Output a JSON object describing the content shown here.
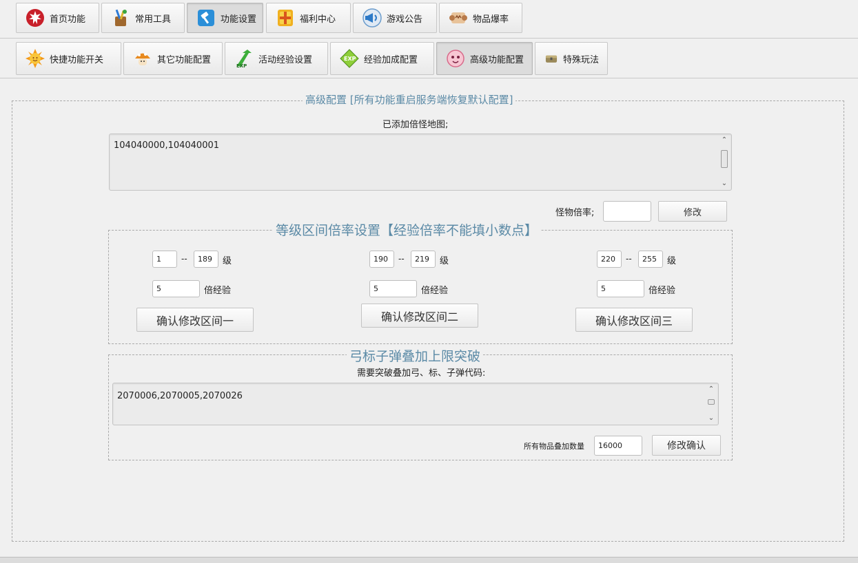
{
  "top_tabs": [
    {
      "label": "首页功能",
      "icon": "maple-leaf-icon"
    },
    {
      "label": "常用工具",
      "icon": "toolbox-icon"
    },
    {
      "label": "功能设置",
      "icon": "hammer-icon"
    },
    {
      "label": "福利中心",
      "icon": "gift-icon"
    },
    {
      "label": "游戏公告",
      "icon": "megaphone-icon"
    },
    {
      "label": "物品爆率",
      "icon": "scroll-icon"
    }
  ],
  "sub_tabs": [
    {
      "label": "快捷功能开关",
      "icon": "sun-icon"
    },
    {
      "label": "其它功能配置",
      "icon": "mushroom-icon"
    },
    {
      "label": "活动经验设置",
      "icon": "exp-arrow-icon"
    },
    {
      "label": "经验加成配置",
      "icon": "exp-diamond-icon"
    },
    {
      "label": "高级功能配置",
      "icon": "pink-bean-icon"
    },
    {
      "label": "特殊玩法",
      "icon": "chest-icon"
    }
  ],
  "advanced": {
    "legend": "高级配置 [所有功能重启服务端恢复默认配置]",
    "maps_label": "已添加倍怪地图;",
    "maps_value": "104040000,104040001",
    "rate_label": "怪物倍率;",
    "rate_value": "",
    "modify_label": "修改"
  },
  "level_ranges": {
    "legend": "等级区间倍率设置【经验倍率不能填小数点】",
    "sep": "--",
    "level_unit": "级",
    "exp_unit": "倍经验",
    "ranges": [
      {
        "from": "1",
        "to": "189",
        "multiplier": "5",
        "button": "确认修改区间一"
      },
      {
        "from": "190",
        "to": "219",
        "multiplier": "5",
        "button": "确认修改区间二"
      },
      {
        "from": "220",
        "to": "255",
        "multiplier": "5",
        "button": "确认修改区间三"
      }
    ]
  },
  "stack": {
    "legend": "弓标子弹叠加上限突破",
    "codes_label": "需要突破叠加弓、标、子弹代码:",
    "codes_value": "2070006,2070005,2070026",
    "qty_label": "所有物品叠加数量",
    "qty_value": "16000",
    "confirm_label": "修改确认"
  }
}
